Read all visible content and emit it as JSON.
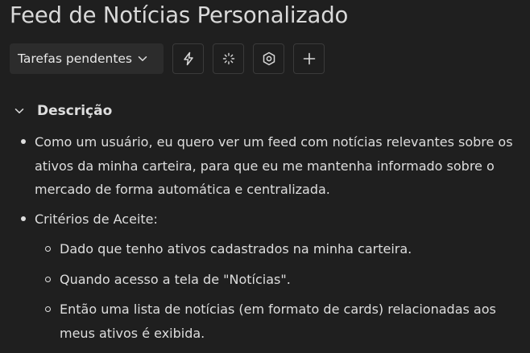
{
  "page": {
    "title": "Feed de Notícias Personalizado"
  },
  "toolbar": {
    "status_label": "Tarefas pendentes",
    "buttons": [
      {
        "icon": "lightning-icon"
      },
      {
        "icon": "loading-icon"
      },
      {
        "icon": "settings-hexagon-icon"
      },
      {
        "icon": "plus-icon"
      }
    ]
  },
  "section": {
    "title": "Descrição",
    "expanded": true,
    "user_story": "Como um usuário, eu quero ver um feed com notícias relevantes sobre os ativos da minha carteira, para que eu me mantenha informado sobre o mercado de forma automática e centralizada.",
    "criteria_label": "Critérios de Aceite:",
    "criteria": [
      "Dado que tenho ativos cadastrados na minha carteira.",
      "Quando acesso a tela de \"Notícias\".",
      "Então uma lista de notícias (em formato de cards) relacionadas aos meus ativos é exibida."
    ]
  },
  "colors": {
    "background": "#1f1f1f",
    "surface": "#2c2c2c",
    "border": "#3b3b3b",
    "text": "#dedede"
  }
}
